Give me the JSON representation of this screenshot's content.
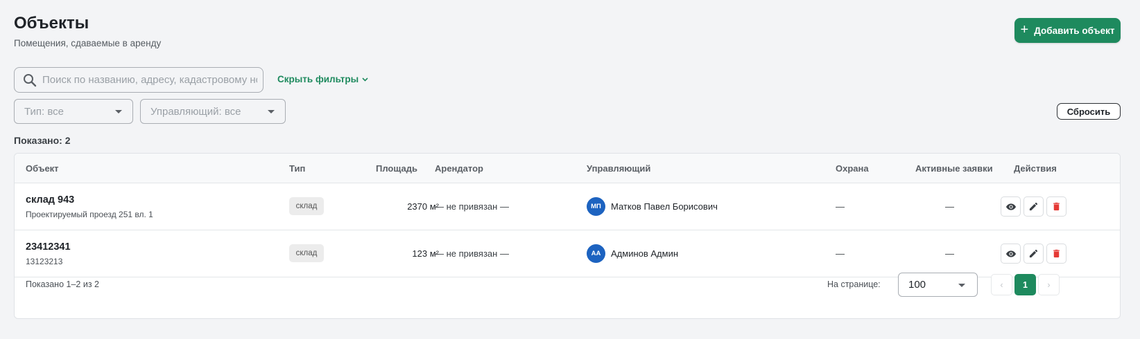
{
  "header": {
    "title": "Объекты",
    "subtitle": "Помещения, сдаваемые в аренду",
    "add_button": "Добавить объект"
  },
  "filters": {
    "search_placeholder": "Поиск по названию, адресу, кадастровому номеру",
    "hide_filters": "Скрыть фильтры",
    "type_select": "Тип: все",
    "manager_select": "Управляющий: все",
    "reset": "Сбросить"
  },
  "shown": {
    "label": "Показано:",
    "count": "2"
  },
  "table": {
    "columns": [
      "Объект",
      "Тип",
      "Площадь",
      "Арендатор",
      "Управляющий",
      "Охрана",
      "Активные заявки",
      "Действия"
    ],
    "rows": [
      {
        "name": "склад 943",
        "address": "Проектируемый проезд 251 вл. 1",
        "type": "склад",
        "area": "2370 м²",
        "tenant": "— не привязан —",
        "manager_initials": "МП",
        "manager": "Матков Павел Борисович",
        "guard": "—",
        "active_requests": "—"
      },
      {
        "name": "23412341",
        "address": "13123213",
        "type": "склад",
        "area": "123 м²",
        "tenant": "— не привязан —",
        "manager_initials": "АА",
        "manager": "Админов Админ",
        "guard": "—",
        "active_requests": "—"
      }
    ]
  },
  "footer": {
    "range_text": "Показано 1–2 из 2",
    "per_page_label": "На странице:",
    "per_page_value": "100",
    "prev": "‹",
    "current_page": "1",
    "next": "›"
  },
  "colors": {
    "accent": "#1e8a5e",
    "avatar": "#1d63c0",
    "danger": "#e53935"
  }
}
